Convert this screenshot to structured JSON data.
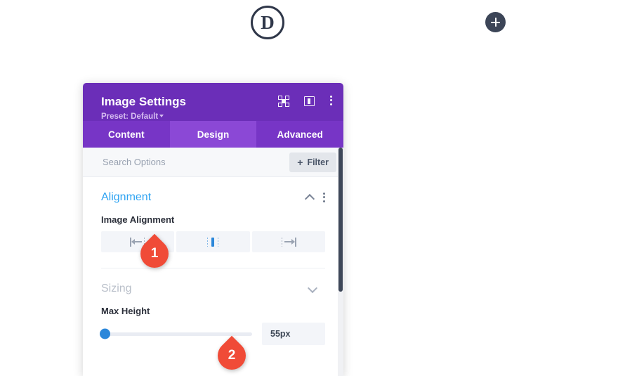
{
  "top_bar": {
    "logo_letter": "D",
    "logo_icon": "divi-circle-logo",
    "add_button_icon": "plus-icon"
  },
  "panel": {
    "title": "Image Settings",
    "preset_label": "Preset: Default",
    "header_icons": [
      {
        "name": "focus-target-icon",
        "label": "Focus"
      },
      {
        "name": "panel-layout-icon",
        "label": "Layout"
      },
      {
        "name": "more-options-kebab-icon",
        "label": "More"
      }
    ],
    "tabs": [
      {
        "label": "Content",
        "active": false
      },
      {
        "label": "Design",
        "active": true
      },
      {
        "label": "Advanced",
        "active": false
      }
    ],
    "search": {
      "placeholder": "Search Options",
      "value": ""
    },
    "filter_button": {
      "label": "Filter",
      "plus": "+"
    },
    "sections": [
      {
        "title": "Alignment",
        "state": "expanded",
        "chevron_icon": "chevron-up-icon",
        "kebab_icon": "section-kebab-icon",
        "fields": [
          {
            "label": "Image Alignment",
            "type": "align-group",
            "options": [
              {
                "name": "align-left",
                "active": false
              },
              {
                "name": "align-center",
                "active": true
              },
              {
                "name": "align-right",
                "active": false
              }
            ]
          }
        ]
      },
      {
        "title": "Sizing",
        "state": "collapsed",
        "chevron_icon": "chevron-down-icon",
        "fields": [
          {
            "label": "Max Height",
            "type": "slider",
            "value": "55px",
            "slider_percent": 0
          }
        ]
      }
    ]
  },
  "callouts": [
    {
      "number": "1"
    },
    {
      "number": "2"
    }
  ],
  "colors": {
    "header_purple": "#6b2eb8",
    "tab_bar_purple": "#7735c6",
    "active_tab_purple": "#8b48d6",
    "accent_blue": "#2ea3f2",
    "slider_blue": "#2b87da",
    "callout_red": "#f04b37",
    "dark_navy": "#3c4557"
  }
}
